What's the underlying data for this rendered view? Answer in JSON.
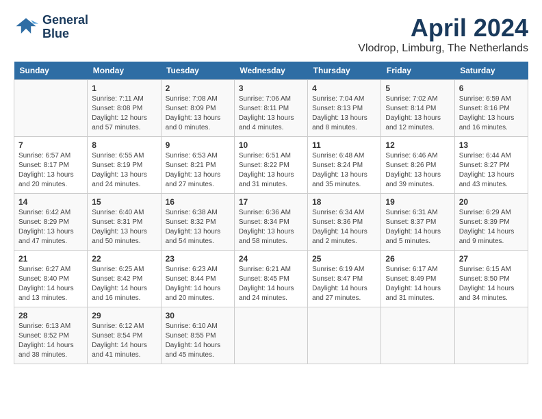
{
  "header": {
    "logo_line1": "General",
    "logo_line2": "Blue",
    "month": "April 2024",
    "location": "Vlodrop, Limburg, The Netherlands"
  },
  "weekdays": [
    "Sunday",
    "Monday",
    "Tuesday",
    "Wednesday",
    "Thursday",
    "Friday",
    "Saturday"
  ],
  "weeks": [
    [
      {
        "day": "",
        "content": ""
      },
      {
        "day": "1",
        "content": "Sunrise: 7:11 AM\nSunset: 8:08 PM\nDaylight: 12 hours\nand 57 minutes."
      },
      {
        "day": "2",
        "content": "Sunrise: 7:08 AM\nSunset: 8:09 PM\nDaylight: 13 hours\nand 0 minutes."
      },
      {
        "day": "3",
        "content": "Sunrise: 7:06 AM\nSunset: 8:11 PM\nDaylight: 13 hours\nand 4 minutes."
      },
      {
        "day": "4",
        "content": "Sunrise: 7:04 AM\nSunset: 8:13 PM\nDaylight: 13 hours\nand 8 minutes."
      },
      {
        "day": "5",
        "content": "Sunrise: 7:02 AM\nSunset: 8:14 PM\nDaylight: 13 hours\nand 12 minutes."
      },
      {
        "day": "6",
        "content": "Sunrise: 6:59 AM\nSunset: 8:16 PM\nDaylight: 13 hours\nand 16 minutes."
      }
    ],
    [
      {
        "day": "7",
        "content": "Sunrise: 6:57 AM\nSunset: 8:17 PM\nDaylight: 13 hours\nand 20 minutes."
      },
      {
        "day": "8",
        "content": "Sunrise: 6:55 AM\nSunset: 8:19 PM\nDaylight: 13 hours\nand 24 minutes."
      },
      {
        "day": "9",
        "content": "Sunrise: 6:53 AM\nSunset: 8:21 PM\nDaylight: 13 hours\nand 27 minutes."
      },
      {
        "day": "10",
        "content": "Sunrise: 6:51 AM\nSunset: 8:22 PM\nDaylight: 13 hours\nand 31 minutes."
      },
      {
        "day": "11",
        "content": "Sunrise: 6:48 AM\nSunset: 8:24 PM\nDaylight: 13 hours\nand 35 minutes."
      },
      {
        "day": "12",
        "content": "Sunrise: 6:46 AM\nSunset: 8:26 PM\nDaylight: 13 hours\nand 39 minutes."
      },
      {
        "day": "13",
        "content": "Sunrise: 6:44 AM\nSunset: 8:27 PM\nDaylight: 13 hours\nand 43 minutes."
      }
    ],
    [
      {
        "day": "14",
        "content": "Sunrise: 6:42 AM\nSunset: 8:29 PM\nDaylight: 13 hours\nand 47 minutes."
      },
      {
        "day": "15",
        "content": "Sunrise: 6:40 AM\nSunset: 8:31 PM\nDaylight: 13 hours\nand 50 minutes."
      },
      {
        "day": "16",
        "content": "Sunrise: 6:38 AM\nSunset: 8:32 PM\nDaylight: 13 hours\nand 54 minutes."
      },
      {
        "day": "17",
        "content": "Sunrise: 6:36 AM\nSunset: 8:34 PM\nDaylight: 13 hours\nand 58 minutes."
      },
      {
        "day": "18",
        "content": "Sunrise: 6:34 AM\nSunset: 8:36 PM\nDaylight: 14 hours\nand 2 minutes."
      },
      {
        "day": "19",
        "content": "Sunrise: 6:31 AM\nSunset: 8:37 PM\nDaylight: 14 hours\nand 5 minutes."
      },
      {
        "day": "20",
        "content": "Sunrise: 6:29 AM\nSunset: 8:39 PM\nDaylight: 14 hours\nand 9 minutes."
      }
    ],
    [
      {
        "day": "21",
        "content": "Sunrise: 6:27 AM\nSunset: 8:40 PM\nDaylight: 14 hours\nand 13 minutes."
      },
      {
        "day": "22",
        "content": "Sunrise: 6:25 AM\nSunset: 8:42 PM\nDaylight: 14 hours\nand 16 minutes."
      },
      {
        "day": "23",
        "content": "Sunrise: 6:23 AM\nSunset: 8:44 PM\nDaylight: 14 hours\nand 20 minutes."
      },
      {
        "day": "24",
        "content": "Sunrise: 6:21 AM\nSunset: 8:45 PM\nDaylight: 14 hours\nand 24 minutes."
      },
      {
        "day": "25",
        "content": "Sunrise: 6:19 AM\nSunset: 8:47 PM\nDaylight: 14 hours\nand 27 minutes."
      },
      {
        "day": "26",
        "content": "Sunrise: 6:17 AM\nSunset: 8:49 PM\nDaylight: 14 hours\nand 31 minutes."
      },
      {
        "day": "27",
        "content": "Sunrise: 6:15 AM\nSunset: 8:50 PM\nDaylight: 14 hours\nand 34 minutes."
      }
    ],
    [
      {
        "day": "28",
        "content": "Sunrise: 6:13 AM\nSunset: 8:52 PM\nDaylight: 14 hours\nand 38 minutes."
      },
      {
        "day": "29",
        "content": "Sunrise: 6:12 AM\nSunset: 8:54 PM\nDaylight: 14 hours\nand 41 minutes."
      },
      {
        "day": "30",
        "content": "Sunrise: 6:10 AM\nSunset: 8:55 PM\nDaylight: 14 hours\nand 45 minutes."
      },
      {
        "day": "",
        "content": ""
      },
      {
        "day": "",
        "content": ""
      },
      {
        "day": "",
        "content": ""
      },
      {
        "day": "",
        "content": ""
      }
    ]
  ]
}
